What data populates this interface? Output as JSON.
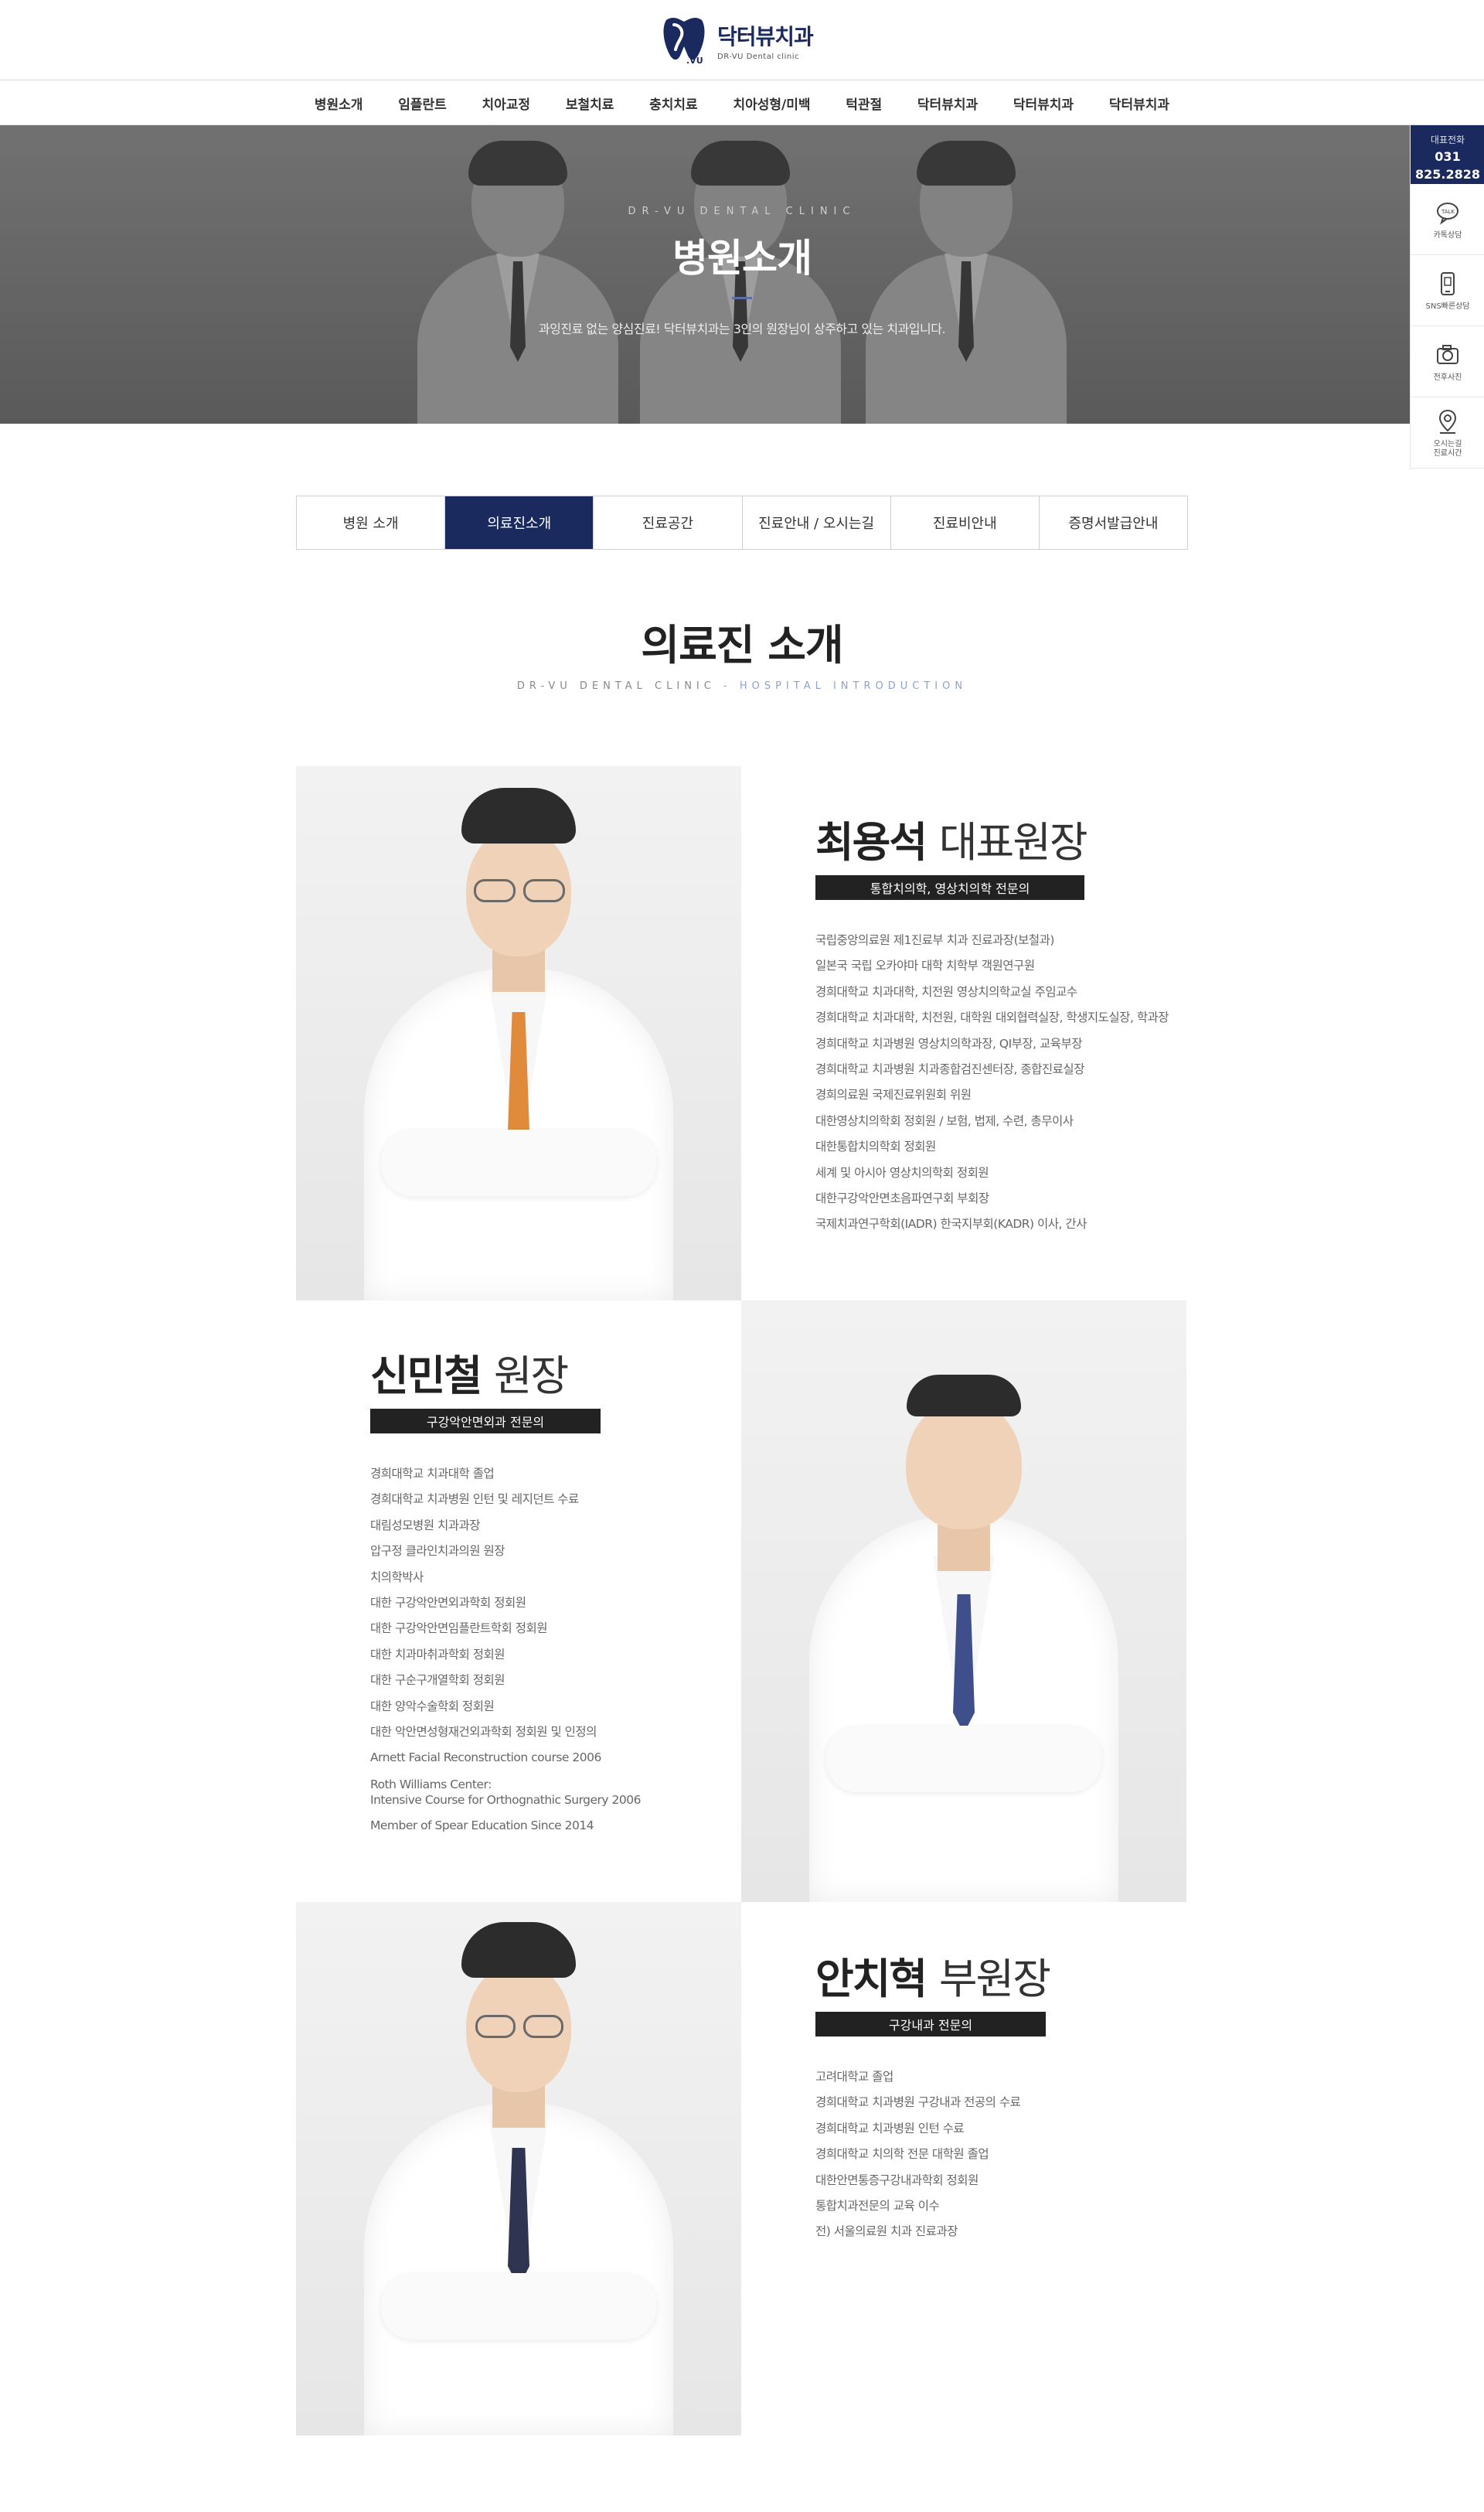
{
  "brand": {
    "name": "닥터뷰치과",
    "sub": "DR-VU Dental clinic",
    "mark_text": ".VU",
    "primary_color": "#1b2a5e"
  },
  "gnb": [
    "병원소개",
    "임플란트",
    "치아교정",
    "보철치료",
    "충치치료",
    "치아성형/미백",
    "턱관절",
    "닥터뷰치과",
    "닥터뷰치과",
    "닥터뷰치과"
  ],
  "hero": {
    "eyebrow": "DR-VU DENTAL CLINIC",
    "title": "병원소개",
    "desc": "과잉진료 없는 양심진료! 닥터뷰치과는 3인의 원장님이 상주하고 있는 치과입니다."
  },
  "quick": {
    "call_title": "대표전화",
    "call_line1": "031",
    "call_line2": "825.2828",
    "items": [
      {
        "icon": "chat-icon",
        "label": "카톡상담"
      },
      {
        "icon": "mobile-icon",
        "label": "SNS빠른상담"
      },
      {
        "icon": "camera-icon",
        "label": "전후사진"
      },
      {
        "icon": "map-pin-icon",
        "label": "오시는길\n진료시간"
      }
    ]
  },
  "tabs": [
    {
      "label": "병원 소개",
      "active": false
    },
    {
      "label": "의료진소개",
      "active": true
    },
    {
      "label": "진료공간",
      "active": false
    },
    {
      "label": "진료안내 / 오시는길",
      "active": false
    },
    {
      "label": "진료비안내",
      "active": false
    },
    {
      "label": "증명서발급안내",
      "active": false
    }
  ],
  "section": {
    "title": "의료진 소개",
    "sub_main": "DR-VU DENTAL CLINIC",
    "sub_sep": " - ",
    "sub_accent": "HOSPITAL INTRODUCTION"
  },
  "doctors": [
    {
      "name": "최용석",
      "role": "대표원장",
      "spec": "통합치의학, 영상치의학 전문의",
      "tie_color": "#e08a3c",
      "career": [
        "국립중앙의료원 제1진료부 치과 진료과장(보철과)",
        "일본국 국립 오카야마 대학 치학부 객원연구원",
        "경희대학교 치과대학, 치전원 영상치의학교실 주임교수",
        "경희대학교 치과대학, 치전원, 대학원 대외협력실장, 학생지도실장, 학과장",
        "경희대학교 치과병원 영상치의학과장, QI부장, 교육부장",
        "경희대학교 치과병원 치과종합검진센터장, 종합진료실장",
        "경희의료원 국제진료위원회 위원",
        "대한영상치의학회 정회원 / 보험, 법제, 수련, 총무이사",
        "대한통합치의학회 정회원",
        "세계 및 아시아 영상치의학회 정회원",
        "대한구강악안면초음파연구회 부회장",
        "국제치과연구학회(IADR) 한국지부회(KADR) 이사, 간사"
      ]
    },
    {
      "name": "신민철",
      "role": "원장",
      "spec": "구강악안면외과 전문의",
      "tie_color": "#3e4f8c",
      "career": [
        "경희대학교 치과대학 졸업",
        "경희대학교 치과병원 인턴 및 레지던트 수료",
        "대림성모병원 치과과장",
        "압구정 클라인치과의원 원장",
        "치의학박사",
        "대한 구강악안면외과학회 정회원",
        "대한 구강악안면임플란트학회 정회원",
        "대한 치과마취과학회 정회원",
        "대한 구순구개열학회 정회원",
        "대한 양악수술학회 정회원",
        "대한 악안면성형재건외과학회 정회원 및 인정의",
        "Arnett Facial Reconstruction course 2006",
        "Roth Williams Center:\nIntensive Course for Orthognathic Surgery 2006",
        "Member of Spear Education Since 2014"
      ]
    },
    {
      "name": "안치혁",
      "role": "부원장",
      "spec": "구강내과 전문의",
      "tie_color": "#2f3550",
      "career": [
        "고려대학교 졸업",
        "경희대학교 치과병원 구강내과 전공의 수료",
        "경희대학교 치과병원 인턴 수료",
        "경희대학교 치의학 전문 대학원 졸업",
        "대한안면통증구강내과학회 정회원",
        "통합치과전문의 교육 이수",
        "전) 서울의료원 치과 진료과장"
      ]
    }
  ]
}
